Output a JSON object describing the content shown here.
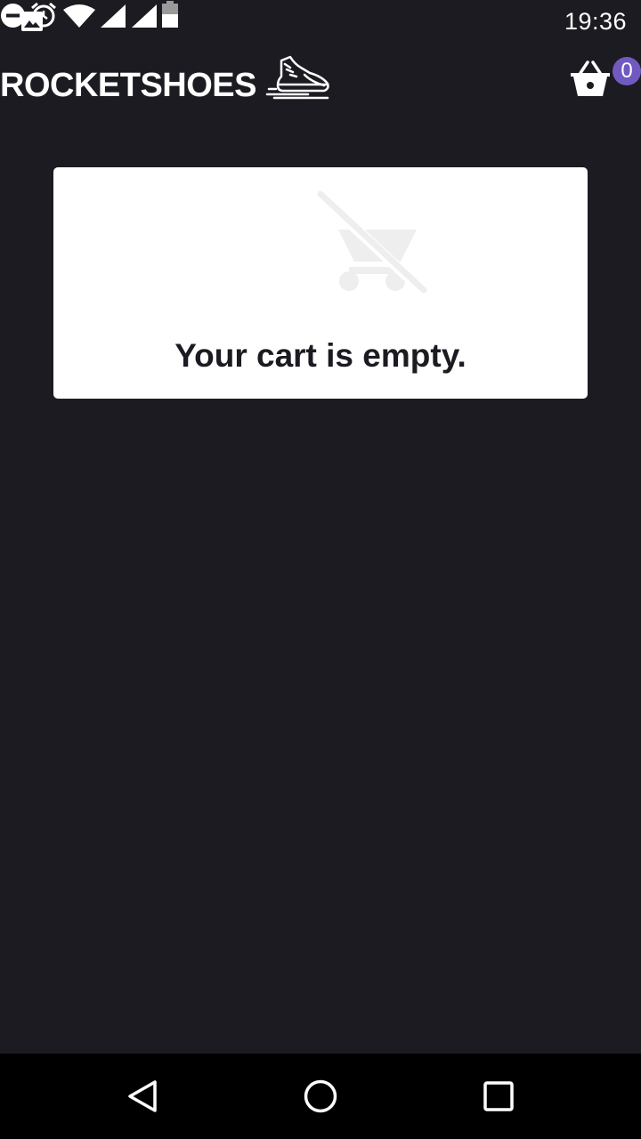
{
  "status_bar": {
    "time": "19:36",
    "icons": [
      "gallery-icon",
      "dnd-icon",
      "alarm-icon",
      "wifi-icon",
      "signal-icon",
      "signal-icon",
      "battery-icon"
    ]
  },
  "header": {
    "brand": "ROCKETSHOES",
    "logo_icon": "running-shoe-icon",
    "cart_icon": "basket-icon",
    "cart_count": "0"
  },
  "empty_cart": {
    "icon": "remove-shopping-cart-icon",
    "message": "Your cart is empty."
  },
  "nav_bar": {
    "buttons": [
      "back-icon",
      "home-icon",
      "recents-icon"
    ]
  },
  "colors": {
    "background": "#1b1b21",
    "card": "#ffffff",
    "badge": "#7159c1",
    "icon_muted": "#eeeeee"
  }
}
